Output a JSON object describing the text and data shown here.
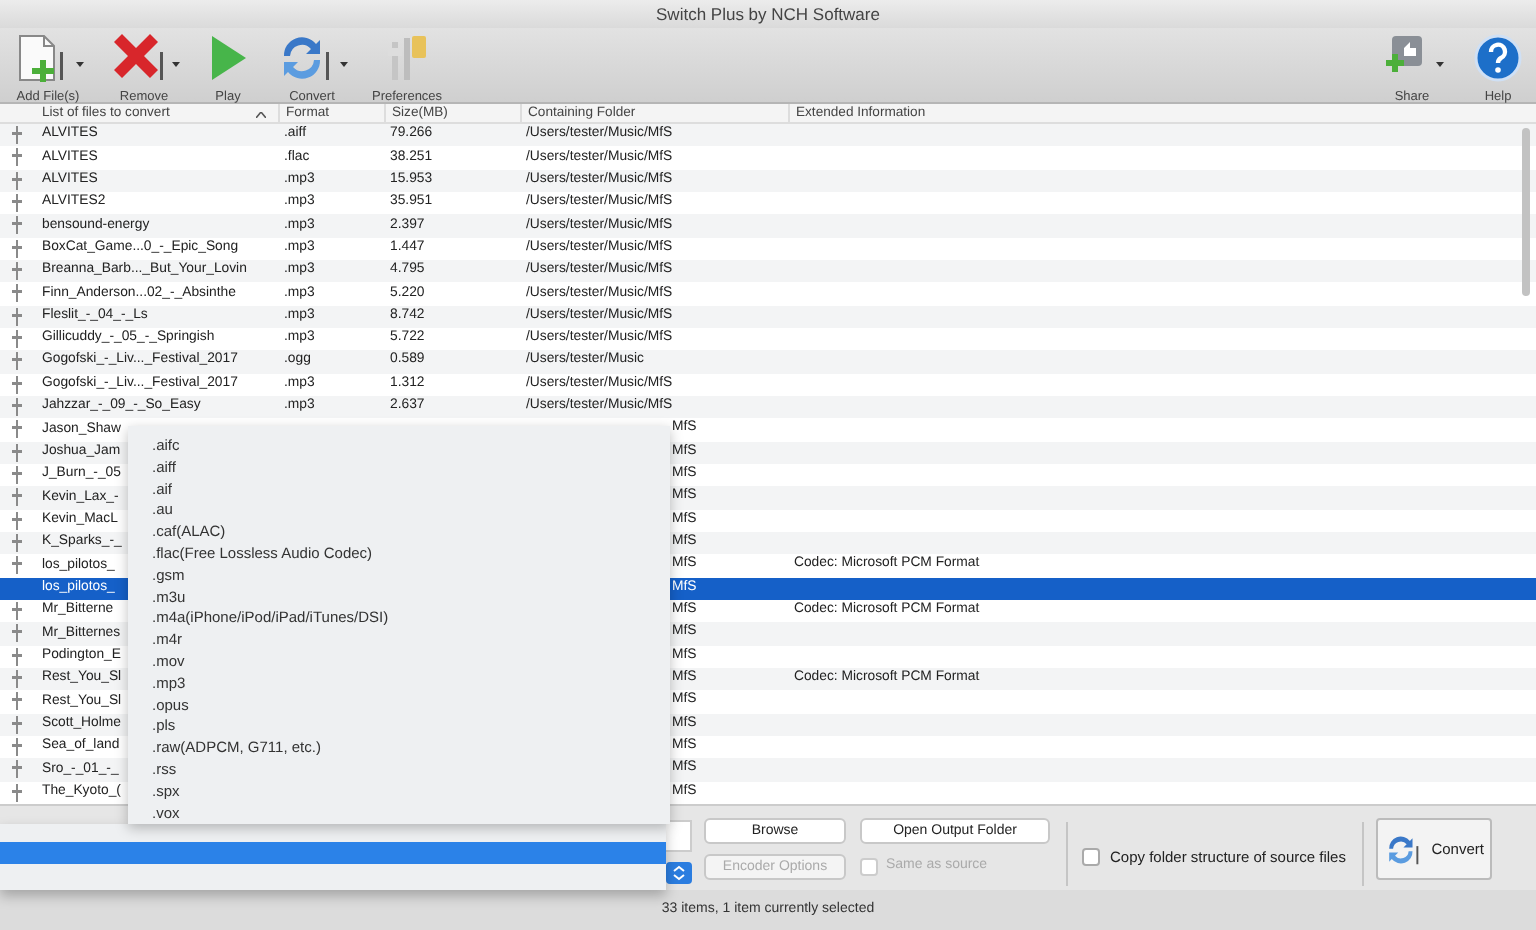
{
  "window": {
    "title": "Switch Plus by NCH Software"
  },
  "toolbar": {
    "left": [
      {
        "label": "Add File(s)",
        "kind": "add",
        "dropdown": true
      },
      {
        "label": "Remove",
        "kind": "remove",
        "dropdown": true
      },
      {
        "label": "Play",
        "kind": "play",
        "dropdown": false
      },
      {
        "label": "Convert",
        "kind": "convert",
        "dropdown": true
      },
      {
        "label": "Preferences",
        "kind": "prefs",
        "dropdown": false
      }
    ],
    "right": [
      {
        "label": "Share",
        "kind": "share",
        "dropdown": true
      },
      {
        "label": "Help",
        "kind": "help",
        "dropdown": false
      }
    ]
  },
  "table": {
    "columns": [
      {
        "label": "List of files to convert",
        "sorted": true
      },
      {
        "label": "Format",
        "sorted": false
      },
      {
        "label": "Size(MB)",
        "sorted": false
      },
      {
        "label": "Containing Folder",
        "sorted": false
      },
      {
        "label": "Extended Information",
        "sorted": false
      }
    ],
    "rows": [
      {
        "kind": "full",
        "name": "ALVITES",
        "format": ".aiff",
        "size": "79.266",
        "folder": "/Users/tester/Music/MfS",
        "selected": false
      },
      {
        "kind": "full",
        "name": "ALVITES",
        "format": ".flac",
        "size": "38.251",
        "folder": "/Users/tester/Music/MfS",
        "selected": false
      },
      {
        "kind": "full",
        "name": "ALVITES",
        "format": ".mp3",
        "size": "15.953",
        "folder": "/Users/tester/Music/MfS",
        "selected": false
      },
      {
        "kind": "full",
        "name": "ALVITES2",
        "format": ".mp3",
        "size": "35.951",
        "folder": "/Users/tester/Music/MfS",
        "selected": false
      },
      {
        "kind": "full",
        "name": "bensound-energy",
        "format": ".mp3",
        "size": "2.397",
        "folder": "/Users/tester/Music/MfS",
        "selected": false
      },
      {
        "kind": "full",
        "name": "BoxCat_Game...0_-_Epic_Song",
        "format": ".mp3",
        "size": "1.447",
        "folder": "/Users/tester/Music/MfS",
        "selected": false
      },
      {
        "kind": "full",
        "name": "Breanna_Barb..._But_Your_Lovin",
        "format": ".mp3",
        "size": "4.795",
        "folder": "/Users/tester/Music/MfS",
        "selected": false
      },
      {
        "kind": "full",
        "name": "Finn_Anderson...02_-_Absinthe",
        "format": ".mp3",
        "size": "5.220",
        "folder": "/Users/tester/Music/MfS",
        "selected": false
      },
      {
        "kind": "full",
        "name": "Fleslit_-_04_-_Ls",
        "format": ".mp3",
        "size": "8.742",
        "folder": "/Users/tester/Music/MfS",
        "selected": false
      },
      {
        "kind": "full",
        "name": "Gillicuddy_-_05_-_Springish",
        "format": ".mp3",
        "size": "5.722",
        "folder": "/Users/tester/Music/MfS",
        "selected": false
      },
      {
        "kind": "full",
        "name": "Gogofski_-_Liv..._Festival_2017",
        "format": ".ogg",
        "size": "0.589",
        "folder": "/Users/tester/Music",
        "selected": false
      },
      {
        "kind": "full",
        "name": "Gogofski_-_Liv..._Festival_2017",
        "format": ".mp3",
        "size": "1.312",
        "folder": "/Users/tester/Music/MfS",
        "selected": false
      },
      {
        "kind": "full",
        "name": "Jahzzar_-_09_-_So_Easy",
        "format": ".mp3",
        "size": "2.637",
        "folder": "/Users/tester/Music/MfS",
        "selected": false
      },
      {
        "kind": "covered",
        "name": "Jason_Shaw",
        "folder": "MfS",
        "selected": false
      },
      {
        "kind": "covered",
        "name": "Joshua_Jam",
        "folder": "MfS",
        "selected": false
      },
      {
        "kind": "covered",
        "name": "J_Burn_-_05",
        "folder": "MfS",
        "selected": false
      },
      {
        "kind": "covered",
        "name": "Kevin_Lax_-",
        "folder": "MfS",
        "selected": false
      },
      {
        "kind": "covered",
        "name": "Kevin_MacL",
        "folder": "MfS",
        "selected": false
      },
      {
        "kind": "covered",
        "name": "K_Sparks_-_",
        "folder": "MfS",
        "selected": false
      },
      {
        "kind": "covered",
        "name": "los_pilotos_",
        "folder": "MfS",
        "info": "Codec: Microsoft PCM Format",
        "selected": false
      },
      {
        "kind": "covered",
        "name": "los_pilotos_",
        "folder": "MfS",
        "selected": true
      },
      {
        "kind": "covered",
        "name": "Mr_Bitterne",
        "folder": "MfS",
        "info": "Codec: Microsoft PCM Format",
        "selected": false
      },
      {
        "kind": "covered",
        "name": "Mr_Bitternes",
        "folder": "MfS",
        "selected": false
      },
      {
        "kind": "covered",
        "name": "Podington_E",
        "folder": "MfS",
        "selected": false
      },
      {
        "kind": "covered",
        "name": "Rest_You_Sl",
        "folder": "MfS",
        "info": "Codec: Microsoft PCM Format",
        "selected": false
      },
      {
        "kind": "covered",
        "name": "Rest_You_Sl",
        "folder": "MfS",
        "selected": false
      },
      {
        "kind": "covered",
        "name": "Scott_Holme",
        "folder": "MfS",
        "selected": false
      },
      {
        "kind": "covered",
        "name": "Sea_of_land",
        "folder": "MfS",
        "selected": false
      },
      {
        "kind": "covered",
        "name": "Sro_-_01_-_",
        "folder": "MfS",
        "selected": false
      },
      {
        "kind": "covered",
        "name": "The_Kyoto_(",
        "folder": "MfS",
        "selected": false
      }
    ]
  },
  "format_menu": {
    "items": [
      ".aifc",
      ".aiff",
      ".aif",
      ".au",
      ".caf(ALAC)",
      ".flac(Free Lossless Audio Codec)",
      ".gsm",
      ".m3u",
      ".m4a(iPhone/iPod/iPad/iTunes/DSI)",
      ".m4r",
      ".mov",
      ".mp3",
      ".opus",
      ".pls",
      ".raw(ADPCM, G711, etc.)",
      ".rss",
      ".spx",
      ".vox"
    ]
  },
  "output": {
    "browse": "Browse",
    "open_folder": "Open Output Folder",
    "encoder": {
      "label": "Encoder Options",
      "disabled": true
    },
    "same_as_source": {
      "label": "Same as source",
      "checked": false,
      "disabled": true
    },
    "copy_structure": {
      "label": "Copy folder structure of source files",
      "checked": false
    },
    "convert": "Convert"
  },
  "status_bar": "33 items, 1 item currently selected"
}
